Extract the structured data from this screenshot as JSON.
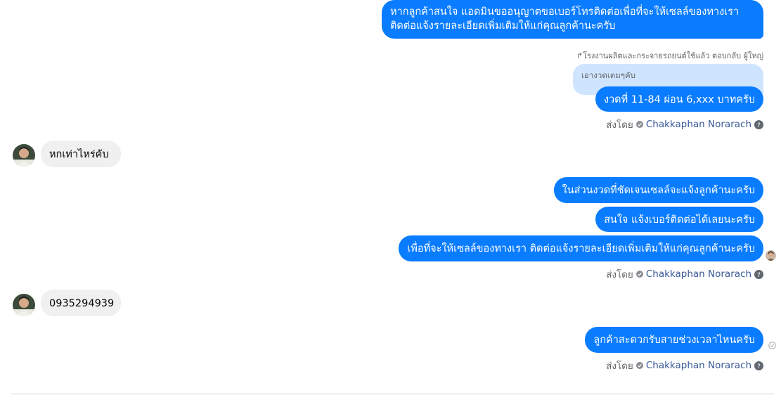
{
  "conversation": {
    "msg_top": "หากลูกค้าสนใจ แอดมินขออนุญาตขอเบอร์โทรติดต่อเพื่อที่จะให้เซลล์ของทางเรา ติดต่อแจ้งรายละเอียดเพิ่มเติมให้แก่คุณลูกค้านะครับ",
    "reply_note": "โรงงานผลิตและกระจายรถยนต์ใช้แล้ว ตอบกลับ ผู้ใหญ่",
    "quoted_text": "เอางวดเตมๆคับ",
    "msg_reply": "งวดที่ 11-84 ผ่อน 6,xxx บาทครับ",
    "in_msg_1": "หกเท่าไหร่คับ",
    "msg_3a": "ในส่วนงวดที่ชัดเจนเซลล์จะแจ้งลูกค้านะครับ",
    "msg_3b": "สนใจ แจ้งเบอร์ติดต่อได้เลยนะครับ",
    "msg_3c": "เพื่อที่จะให้เซลล์ของทางเรา ติดต่อแจ้งรายละเอียดเพิ่มเติมให้แก่คุณลูกค้านะครับ",
    "in_msg_2": "0935294939",
    "msg_4": "ลูกค้าสะดวกรับสายช่วงเวลาไหนครับ",
    "sent_by_prefix": "ส่งโดย",
    "sender_name": "Chakkaphan Norarach"
  },
  "icons": {
    "reply": "reply-arrow-icon",
    "verified": "verified-check-icon",
    "help": "question-mark-icon",
    "read_receipt": "read-receipt-icon"
  },
  "colors": {
    "outgoing_bubble": "#0a7cff",
    "incoming_bubble": "#f0f0f0",
    "quoted_bubble": "#cfe4ff",
    "meta_text": "#65676b",
    "sender_name": "#385898"
  }
}
